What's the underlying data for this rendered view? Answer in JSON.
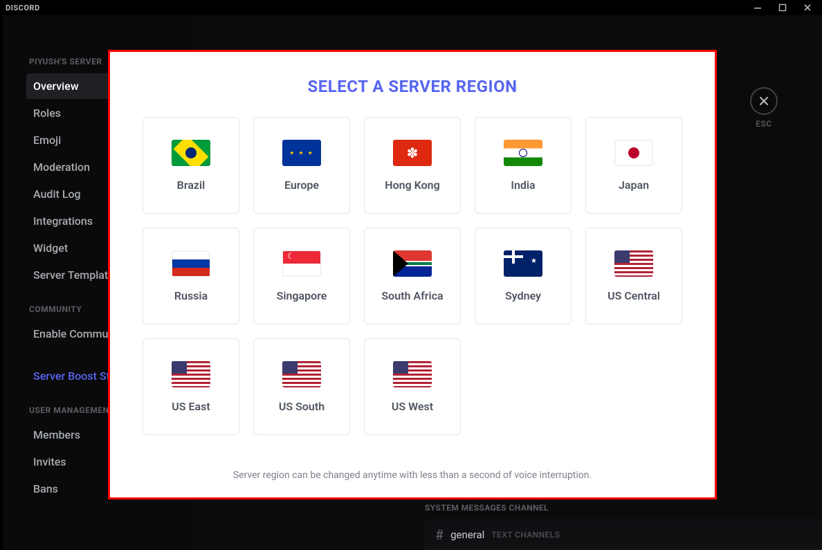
{
  "titlebar": {
    "brand": "DISCORD"
  },
  "close": {
    "esc": "ESC"
  },
  "sidebar": {
    "section1_heading": "PIYUSH'S SERVER",
    "section1_items": [
      {
        "label": "Overview",
        "selected": true
      },
      {
        "label": "Roles"
      },
      {
        "label": "Emoji"
      },
      {
        "label": "Moderation"
      },
      {
        "label": "Audit Log"
      },
      {
        "label": "Integrations"
      },
      {
        "label": "Widget"
      },
      {
        "label": "Server Template"
      }
    ],
    "section2_heading": "COMMUNITY",
    "section2_items": [
      {
        "label": "Enable Community"
      }
    ],
    "boost_label": "Server Boost Status",
    "section3_heading": "USER MANAGEMENT",
    "section3_items": [
      {
        "label": "Members"
      },
      {
        "label": "Invites"
      },
      {
        "label": "Bans"
      }
    ]
  },
  "system_channel": {
    "label": "SYSTEM MESSAGES CHANNEL",
    "channel": "general",
    "sub": "TEXT CHANNELS"
  },
  "modal": {
    "title": "SELECT A SERVER REGION",
    "footer": "Server region can be changed anytime with less than a second of voice interruption.",
    "regions": [
      {
        "name": "Brazil",
        "flag": "brazil"
      },
      {
        "name": "Europe",
        "flag": "europe"
      },
      {
        "name": "Hong Kong",
        "flag": "hk"
      },
      {
        "name": "India",
        "flag": "india"
      },
      {
        "name": "Japan",
        "flag": "japan"
      },
      {
        "name": "Russia",
        "flag": "russia"
      },
      {
        "name": "Singapore",
        "flag": "singapore"
      },
      {
        "name": "South Africa",
        "flag": "sa"
      },
      {
        "name": "Sydney",
        "flag": "sydney"
      },
      {
        "name": "US Central",
        "flag": "us"
      },
      {
        "name": "US East",
        "flag": "us"
      },
      {
        "name": "US South",
        "flag": "us"
      },
      {
        "name": "US West",
        "flag": "us"
      }
    ]
  }
}
